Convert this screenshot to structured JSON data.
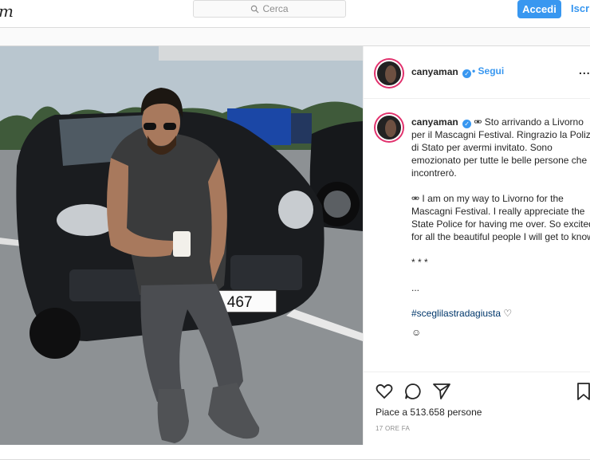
{
  "topbar": {
    "logo": "m",
    "search_placeholder": "Cerca",
    "login_label": "Accedi",
    "signup_label": "Iscriviti"
  },
  "post": {
    "username": "canyaman",
    "follow_label": "Segui",
    "more_label": "...",
    "caption_it": "Sto arrivando a Livorno per il Mascagni Festival. Ringrazio la Polizia di Stato per avermi invitato. Sono emozionato per tutte le belle persone che incontrerò.",
    "caption_en": "I am on my way to Livorno for the Mascagni Festival. I really appreciate the State Police for having me over. So excited for all the beautiful people I will get to know.",
    "stars": "* * *",
    "dots": "...",
    "hashtag": "#sceglilastradagiusta",
    "license_plate": "B  A 467",
    "likes_text": "Piace a 513.658 persone",
    "time_ago": "17 ORE FA"
  },
  "colors": {
    "accent": "#3897f0",
    "story_ring": "#e1306c",
    "border": "#dbdbdb"
  },
  "icons": [
    "search-icon",
    "verified-icon",
    "heart-icon",
    "comment-icon",
    "share-icon",
    "bookmark-icon",
    "emoji-icon"
  ]
}
